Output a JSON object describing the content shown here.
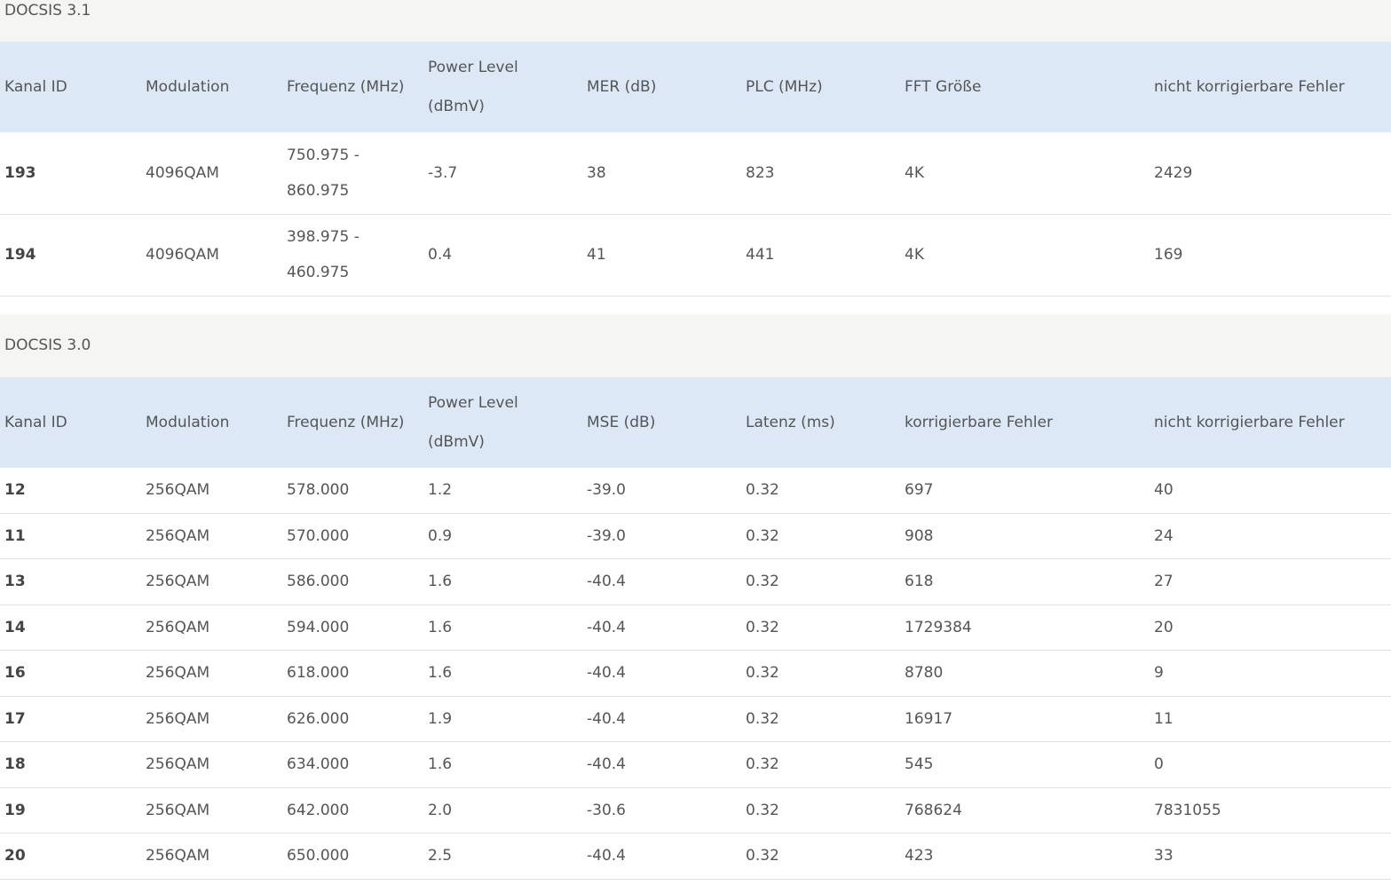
{
  "docsis31": {
    "title": "DOCSIS 3.1",
    "headers": [
      "Kanal ID",
      "Modulation",
      "Frequenz (MHz)",
      "Power Level\n(dBmV)",
      "MER (dB)",
      "PLC (MHz)",
      "FFT Größe",
      "nicht korrigierbare Fehler"
    ],
    "rows": [
      [
        "193",
        "4096QAM",
        "750.975 -\n860.975",
        "-3.7",
        "38",
        "823",
        "4K",
        "2429"
      ],
      [
        "194",
        "4096QAM",
        "398.975 -\n460.975",
        "0.4",
        "41",
        "441",
        "4K",
        "169"
      ]
    ]
  },
  "docsis30": {
    "title": "DOCSIS 3.0",
    "headers": [
      "Kanal ID",
      "Modulation",
      "Frequenz (MHz)",
      "Power Level\n(dBmV)",
      "MSE (dB)",
      "Latenz (ms)",
      "korrigierbare Fehler",
      "nicht korrigierbare Fehler"
    ],
    "rows": [
      [
        "12",
        "256QAM",
        "578.000",
        "1.2",
        "-39.0",
        "0.32",
        "697",
        "40"
      ],
      [
        "11",
        "256QAM",
        "570.000",
        "0.9",
        "-39.0",
        "0.32",
        "908",
        "24"
      ],
      [
        "13",
        "256QAM",
        "586.000",
        "1.6",
        "-40.4",
        "0.32",
        "618",
        "27"
      ],
      [
        "14",
        "256QAM",
        "594.000",
        "1.6",
        "-40.4",
        "0.32",
        "1729384",
        "20"
      ],
      [
        "16",
        "256QAM",
        "618.000",
        "1.6",
        "-40.4",
        "0.32",
        "8780",
        "9"
      ],
      [
        "17",
        "256QAM",
        "626.000",
        "1.9",
        "-40.4",
        "0.32",
        "16917",
        "11"
      ],
      [
        "18",
        "256QAM",
        "634.000",
        "1.6",
        "-40.4",
        "0.32",
        "545",
        "0"
      ],
      [
        "19",
        "256QAM",
        "642.000",
        "2.0",
        "-30.6",
        "0.32",
        "768624",
        "7831055"
      ],
      [
        "20",
        "256QAM",
        "650.000",
        "2.5",
        "-40.4",
        "0.32",
        "423",
        "33"
      ]
    ]
  }
}
